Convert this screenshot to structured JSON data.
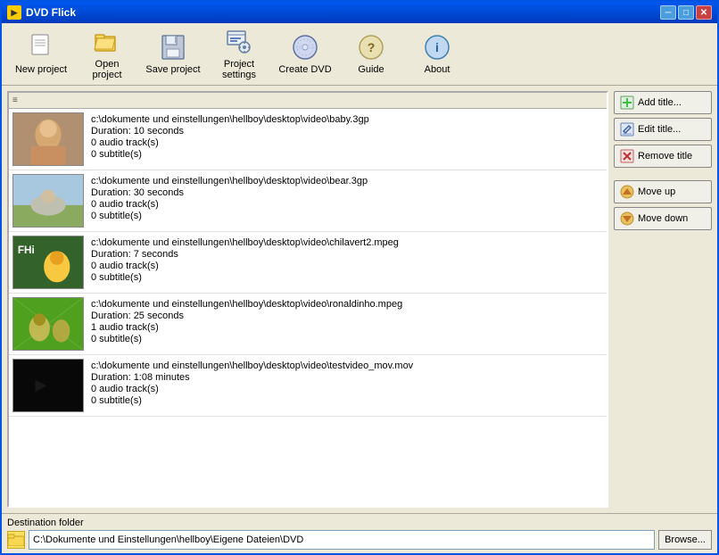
{
  "window": {
    "title": "DVD Flick"
  },
  "titlebar": {
    "title": "DVD Flick",
    "min_label": "─",
    "max_label": "□",
    "close_label": "✕"
  },
  "toolbar": {
    "buttons": [
      {
        "id": "new-project",
        "label": "New project",
        "icon": "new-icon"
      },
      {
        "id": "open-project",
        "label": "Open project",
        "icon": "open-icon"
      },
      {
        "id": "save-project",
        "label": "Save project",
        "icon": "save-icon"
      },
      {
        "id": "project-settings",
        "label": "Project settings",
        "icon": "settings-icon"
      },
      {
        "id": "create-dvd",
        "label": "Create DVD",
        "icon": "dvd-icon"
      },
      {
        "id": "guide",
        "label": "Guide",
        "icon": "guide-icon"
      },
      {
        "id": "about",
        "label": "About",
        "icon": "about-icon"
      }
    ]
  },
  "list_header": {
    "label": "≡"
  },
  "items": [
    {
      "id": "baby",
      "path": "c:\\dokumente und einstellungen\\hellboy\\desktop\\video\\baby.3gp",
      "duration": "Duration: 10 seconds",
      "audio": "0 audio track(s)",
      "subtitle": "0 subtitle(s)",
      "thumb_class": "thumb-baby",
      "selected": false
    },
    {
      "id": "bear",
      "path": "c:\\dokumente und einstellungen\\hellboy\\desktop\\video\\bear.3gp",
      "duration": "Duration: 30 seconds",
      "audio": "0 audio track(s)",
      "subtitle": "0 subtitle(s)",
      "thumb_class": "thumb-bear",
      "selected": false
    },
    {
      "id": "chilavert",
      "path": "c:\\dokumente und einstellungen\\hellboy\\desktop\\video\\chilavert2.mpeg",
      "duration": "Duration: 7 seconds",
      "audio": "0 audio track(s)",
      "subtitle": "0 subtitle(s)",
      "thumb_class": "thumb-chilavert",
      "selected": false
    },
    {
      "id": "ronaldinho",
      "path": "c:\\dokumente und einstellungen\\hellboy\\desktop\\video\\ronaldinho.mpeg",
      "duration": "Duration: 25 seconds",
      "audio": "1 audio track(s)",
      "subtitle": "0 subtitle(s)",
      "thumb_class": "thumb-ronaldinho",
      "selected": false
    },
    {
      "id": "testvideo",
      "path": "c:\\dokumente und einstellungen\\hellboy\\desktop\\video\\testvideo_mov.mov",
      "duration": "Duration: 1:08 minutes",
      "audio": "0 audio track(s)",
      "subtitle": "0 subtitle(s)",
      "thumb_class": "thumb-testvideo",
      "selected": false
    }
  ],
  "side_buttons": [
    {
      "id": "add-title",
      "label": "Add title...",
      "icon": "add-icon"
    },
    {
      "id": "edit-title",
      "label": "Edit title...",
      "icon": "edit-icon"
    },
    {
      "id": "remove-title",
      "label": "Remove title",
      "icon": "remove-icon"
    },
    {
      "id": "move-up",
      "label": "Move up",
      "icon": "up-icon"
    },
    {
      "id": "move-down",
      "label": "Move down",
      "icon": "down-icon"
    }
  ],
  "bottom": {
    "dest_label": "Destination folder",
    "dest_path": "C:\\Dokumente und Einstellungen\\hellboy\\Eigene Dateien\\DVD",
    "browse_label": "Browse..."
  },
  "colors": {
    "window_border": "#0054e3",
    "titlebar_start": "#0058ee",
    "titlebar_end": "#003bbd",
    "bg": "#ece9d8"
  }
}
